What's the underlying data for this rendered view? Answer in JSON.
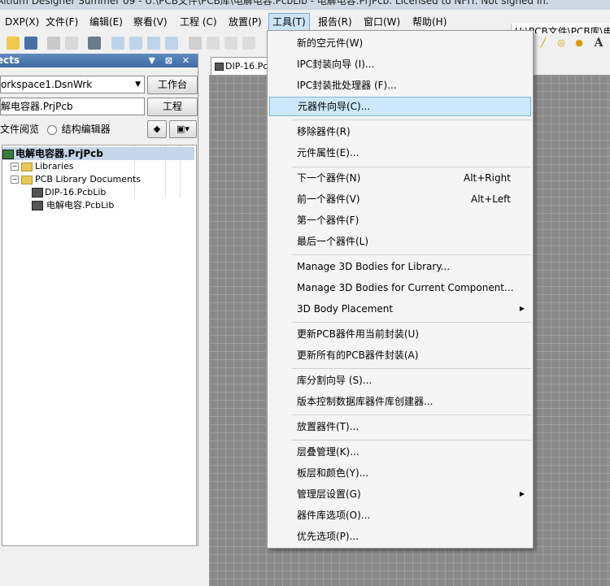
{
  "window": {
    "title": "Altium Designer Summer 09 - U:\\PCB文件\\PCB库\\电解电容.PcbLib - 电解电容.PrjPcb. Licensed to NFIT. Not signed in."
  },
  "menubar": {
    "items": [
      "DXP(X)",
      "文件(F)",
      "编辑(E)",
      "察看(V)",
      "工程 (C)",
      "放置(P)",
      "工具(T)",
      "报告(R)",
      "窗口(W)",
      "帮助(H)"
    ],
    "active": "工具(T)",
    "path": "U:\\PCB文件\\PCB库\\电"
  },
  "panel": {
    "title": "ects",
    "workspace_value": "orkspace1.DsnWrk",
    "workspace_button": "工作台",
    "project_value": "解电容器.PrjPcb",
    "project_button": "工程",
    "view_file": "文件阅览",
    "view_struct": "结构编辑器",
    "tree": {
      "project": "电解电容器.PrjPcb",
      "libraries": "Libraries",
      "pcb_docs": "PCB Library Documents",
      "doc1": "DIP-16.PcbLib",
      "doc2": "电解电容.PcbLib"
    }
  },
  "doc_tab": {
    "label": "DIP-16.Pc"
  },
  "tools_menu": {
    "items": [
      {
        "label": "新的空元件(W)",
        "shortcut": "",
        "submenu": false
      },
      {
        "label": "IPC封装向导 (I)...",
        "shortcut": "",
        "submenu": false
      },
      {
        "label": "IPC封装批处理器 (F)...",
        "shortcut": "",
        "submenu": false
      },
      {
        "label": "元器件向导(C)...",
        "shortcut": "",
        "submenu": false,
        "highlighted": true
      },
      {
        "label": "移除器件(R)",
        "shortcut": "",
        "submenu": false
      },
      {
        "label": "元件属性(E)...",
        "shortcut": "",
        "submenu": false
      },
      {
        "label": "下一个器件(N)",
        "shortcut": "Alt+Right",
        "submenu": false
      },
      {
        "label": "前一个器件(V)",
        "shortcut": "Alt+Left",
        "submenu": false
      },
      {
        "label": "第一个器件(F)",
        "shortcut": "",
        "submenu": false
      },
      {
        "label": "最后一个器件(L)",
        "shortcut": "",
        "submenu": false
      },
      {
        "label": "Manage 3D Bodies for Library...",
        "shortcut": "",
        "submenu": false
      },
      {
        "label": "Manage 3D Bodies for Current Component...",
        "shortcut": "",
        "submenu": false
      },
      {
        "label": "3D Body Placement",
        "shortcut": "",
        "submenu": true
      },
      {
        "label": "更新PCB器件用当前封装(U)",
        "shortcut": "",
        "submenu": false
      },
      {
        "label": "更新所有的PCB器件封装(A)",
        "shortcut": "",
        "submenu": false
      },
      {
        "label": "库分割向导 (S)...",
        "shortcut": "",
        "submenu": false
      },
      {
        "label": "版本控制数据库器件库创建器...",
        "shortcut": "",
        "submenu": false
      },
      {
        "label": "放置器件(T)...",
        "shortcut": "",
        "submenu": false
      },
      {
        "label": "层叠管理(K)...",
        "shortcut": "",
        "submenu": false
      },
      {
        "label": "板层和颜色(Y)...",
        "shortcut": "",
        "submenu": false
      },
      {
        "label": "管理层设置(G)",
        "shortcut": "",
        "submenu": true
      },
      {
        "label": "器件库选项(O)...",
        "shortcut": "",
        "submenu": false
      },
      {
        "label": "优先选项(P)...",
        "shortcut": "",
        "submenu": false
      }
    ]
  },
  "icons": {
    "submenu_arrow": "▶",
    "combo_arrow": "▼",
    "expander": "−"
  },
  "colors": {
    "highlight": "#cde8fb",
    "selection": "#3399ff",
    "panel_header": "#3d6ba3"
  }
}
